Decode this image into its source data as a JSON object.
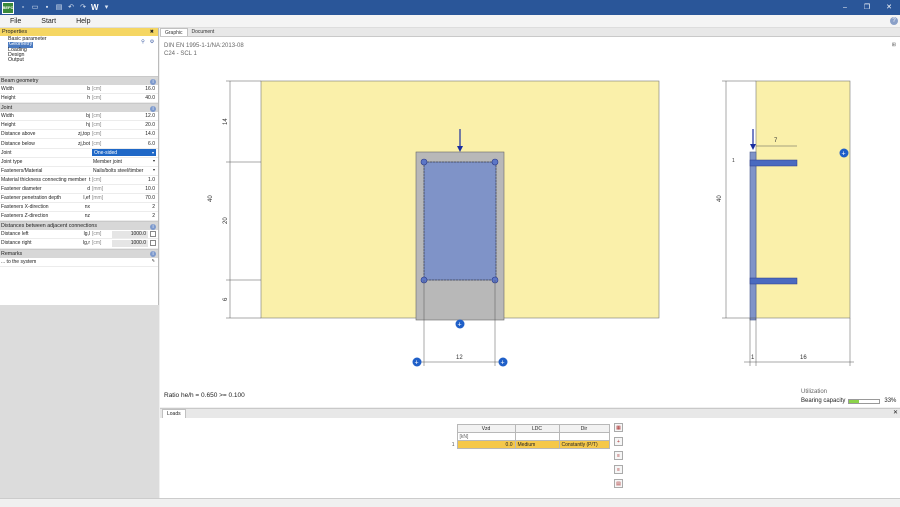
{
  "titlebar": {
    "logo": "BEFO",
    "quick_icons": [
      "new-file-icon",
      "open-folder-icon",
      "save-icon",
      "print-icon",
      "undo-icon",
      "redo-icon"
    ],
    "word_icon": "W",
    "pin_icon": "pin-icon"
  },
  "menu": {
    "items": [
      "File",
      "Start",
      "Help"
    ]
  },
  "properties": {
    "header": "Properties",
    "tree": [
      "Basic parameter",
      "Loading",
      "Design",
      "Output"
    ],
    "tree_selected": "Geometry",
    "sections": {
      "beam_geometry": "Beam geometry",
      "joint": "Joint",
      "distances": "Distances between adjacent connections",
      "remarks": "Remarks"
    },
    "beam_rows": [
      {
        "label": "Width",
        "sym": "b",
        "unit": "[cm]",
        "value": "16.0"
      },
      {
        "label": "Height",
        "sym": "h",
        "unit": "[cm]",
        "value": "40.0"
      }
    ],
    "joint_rows": [
      {
        "label": "Width",
        "sym": "bj",
        "unit": "[cm]",
        "value": "12.0"
      },
      {
        "label": "Height",
        "sym": "hj",
        "unit": "[cm]",
        "value": "20.0"
      },
      {
        "label": "Distance above",
        "sym": "zj,top",
        "unit": "[cm]",
        "value": "14.0"
      },
      {
        "label": "Distance below",
        "sym": "zj,bot",
        "unit": "[cm]",
        "value": "6.0"
      }
    ],
    "joint_select": {
      "label": "Joint",
      "value": "One-sided"
    },
    "joint_type": {
      "label": "Joint type",
      "value": "Member joint"
    },
    "fasteners_material": {
      "label": "Fasteners/Material",
      "value": "Nails/bolts steel/timber"
    },
    "fastener_rows": [
      {
        "label": "Material thickness connecting member",
        "sym": "t",
        "unit": "[cm]",
        "value": "1.0"
      },
      {
        "label": "Fastener diameter",
        "sym": "d",
        "unit": "[mm]",
        "value": "10.0"
      },
      {
        "label": "Fastener penetration depth",
        "sym": "l,ef",
        "unit": "[mm]",
        "value": "70.0"
      },
      {
        "label": "Fasteners X-direction",
        "sym": "nx",
        "unit": "",
        "value": "2"
      },
      {
        "label": "Fasteners Z-direction",
        "sym": "nz",
        "unit": "",
        "value": "2"
      }
    ],
    "distance_rows": [
      {
        "label": "Distance left",
        "sym": "lg,l",
        "unit": "[cm]",
        "value": "1000.0"
      },
      {
        "label": "Distance right",
        "sym": "lg,r",
        "unit": "[cm]",
        "value": "1000.0"
      }
    ],
    "remarks_row": "... to the system"
  },
  "graphic": {
    "tabs": [
      "Graphic",
      "Document"
    ],
    "norm": "DIN EN 1995-1-1/NA:2013-08",
    "material": "C24 - SCL 1",
    "dims": {
      "left_14": "14",
      "left_40": "40",
      "left_20": "20",
      "left_6": "6",
      "bottom_12": "12",
      "right_40": "40",
      "right_7": "7",
      "right_1a": "1",
      "right_1b": "1",
      "right_16": "16"
    },
    "ratio": "Ratio he/h = 0.650 >= 0.100",
    "utilization_label": "Utilization",
    "bearing_label": "Bearing capacity",
    "bearing_value": 0.33,
    "bearing_text": "33%",
    "colors": {
      "timber": "#faf0aa",
      "steel": "#b8b8b8",
      "plate": "#7f93c8",
      "fastener": "#4a6ac0"
    }
  },
  "loads": {
    "tab": "Loads",
    "headers": [
      "Vzd",
      "LDC",
      "Dir"
    ],
    "units": [
      "[kN]",
      "",
      ""
    ],
    "rows": [
      {
        "index": "1",
        "vzd": "0.0",
        "ldc": "Medium",
        "dir": "Constantly (P/T)"
      }
    ]
  }
}
